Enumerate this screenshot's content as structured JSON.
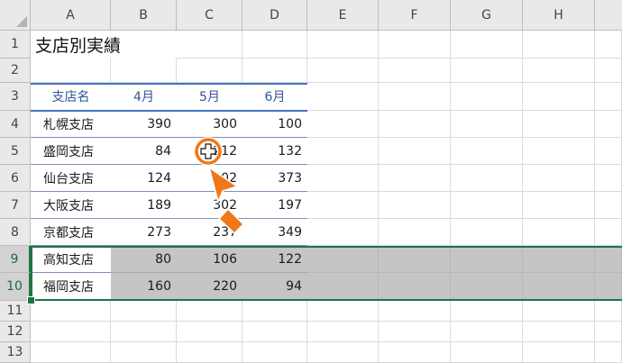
{
  "columns": [
    "A",
    "B",
    "C",
    "D",
    "E",
    "F",
    "G",
    "H"
  ],
  "rows": [
    "1",
    "2",
    "3",
    "4",
    "5",
    "6",
    "7",
    "8",
    "9",
    "10",
    "11",
    "12",
    "13"
  ],
  "sheet_title": "支店別実績",
  "table": {
    "headers": [
      "支店名",
      "4月",
      "5月",
      "6月"
    ],
    "rows": [
      {
        "name": "札幌支店",
        "apr": "390",
        "may": "300",
        "jun": "100"
      },
      {
        "name": "盛岡支店",
        "apr": "84",
        "may": "212",
        "jun": "132"
      },
      {
        "name": "仙台支店",
        "apr": "124",
        "may": "302",
        "jun": "373"
      },
      {
        "name": "大阪支店",
        "apr": "189",
        "may": "302",
        "jun": "197"
      },
      {
        "name": "京都支店",
        "apr": "273",
        "may": "237",
        "jun": "349"
      },
      {
        "name": "高知支店",
        "apr": "80",
        "may": "106",
        "jun": "122"
      },
      {
        "name": "福岡支店",
        "apr": "160",
        "may": "220",
        "jun": "94"
      }
    ]
  },
  "selected_rows": [
    "9",
    "10"
  ],
  "colors": {
    "selection_green": "#217346",
    "table_rule_blue": "#4472c4",
    "highlight_gray": "#c5c5c5",
    "annotation_orange": "#f07818"
  },
  "icons": {
    "cursor": "plus-cursor-icon",
    "annotation": "pointer-arrow-icon"
  }
}
